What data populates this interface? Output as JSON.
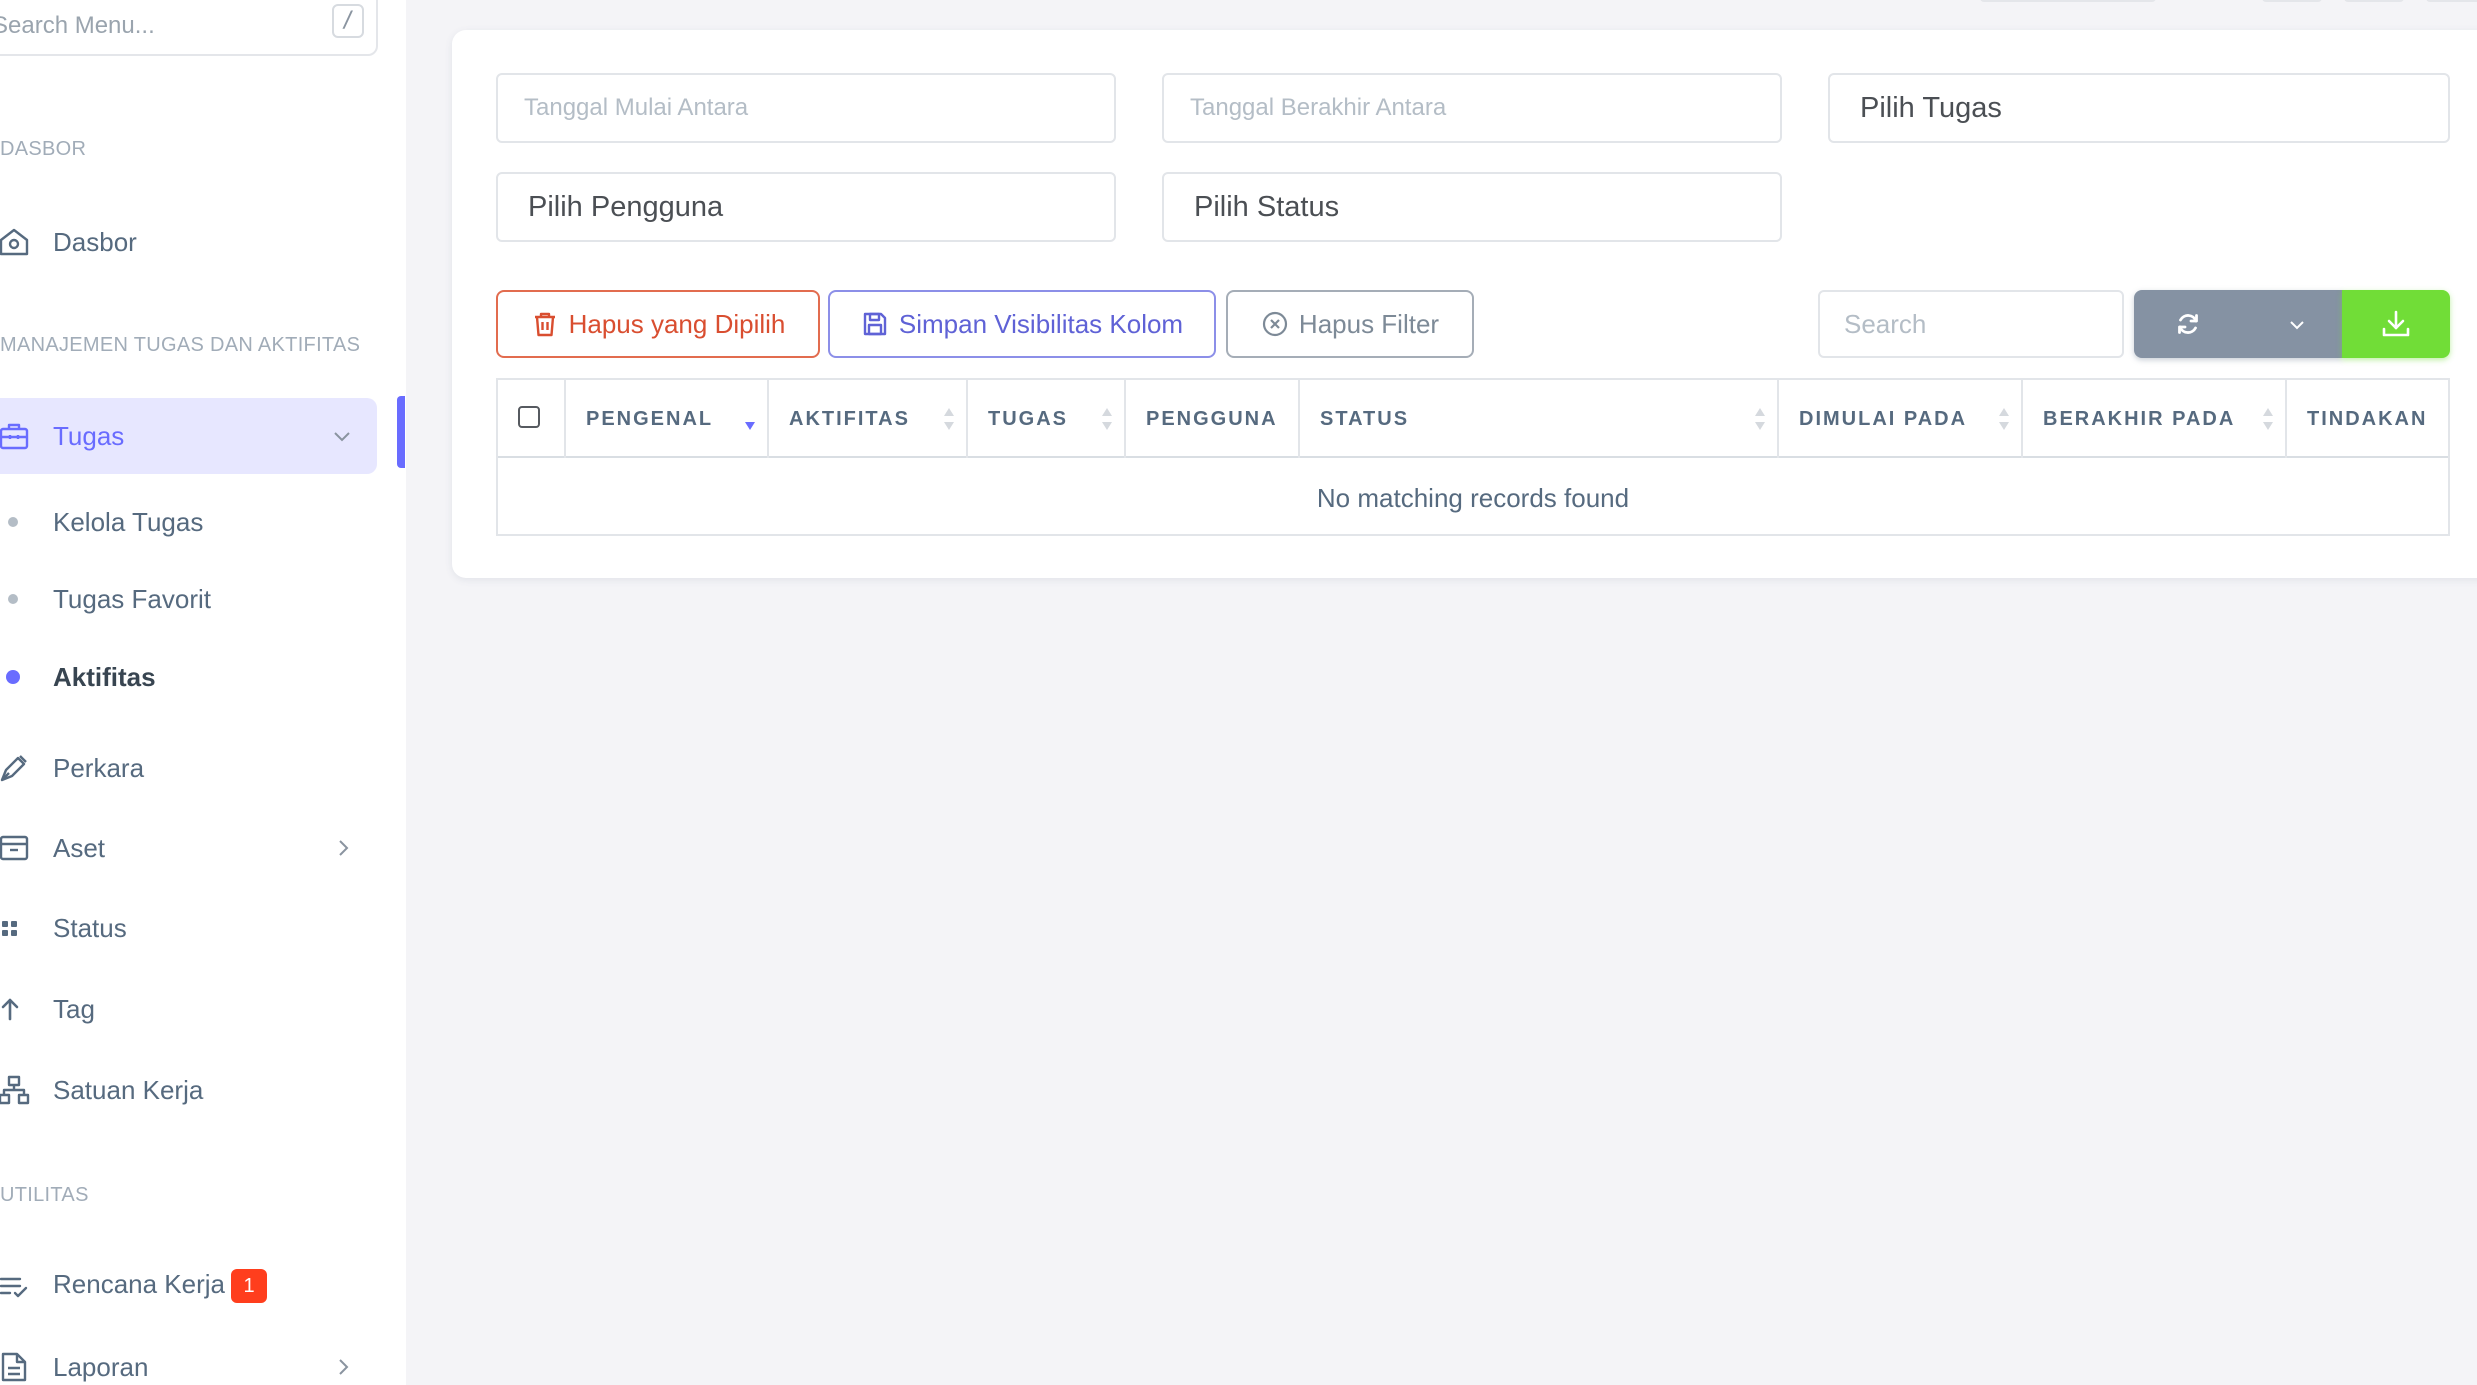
{
  "sidebar": {
    "search_placeholder": "Search Menu...",
    "search_shortcut": "/",
    "section_dashboard": "DASBOR",
    "section_tasks": "MANAJEMEN TUGAS DAN AKTIFITAS",
    "section_utilities": "UTILITAS",
    "items": {
      "dashboard": "Dasbor",
      "tasks": "Tugas",
      "manage_tasks": "Kelola Tugas",
      "favorite_tasks": "Tugas Favorit",
      "activities": "Aktifitas",
      "cases": "Perkara",
      "assets": "Aset",
      "status": "Status",
      "tag": "Tag",
      "work_unit": "Satuan Kerja",
      "work_plan": "Rencana Kerja",
      "work_plan_badge": "1",
      "reports": "Laporan"
    }
  },
  "filters": {
    "start_date_placeholder": "Tanggal Mulai Antara",
    "end_date_placeholder": "Tanggal Berakhir Antara",
    "task_select": "Pilih Tugas",
    "user_select": "Pilih Pengguna",
    "status_select": "Pilih Status"
  },
  "toolbar": {
    "delete_selected": "Hapus yang Dipilih",
    "save_column_visibility": "Simpan Visibilitas Kolom",
    "clear_filter": "Hapus Filter",
    "search_placeholder": "Search"
  },
  "table": {
    "columns": [
      "PENGENAL",
      "AKTIFITAS",
      "TUGAS",
      "PENGGUNA",
      "STATUS",
      "DIMULAI PADA",
      "BERAKHIR PADA",
      "TINDAKAN"
    ],
    "empty_message": "No matching records found"
  },
  "colors": {
    "primary": "#696cff",
    "danger": "#ff3e1d",
    "secondary": "#8592a3",
    "success": "#71dd37"
  }
}
